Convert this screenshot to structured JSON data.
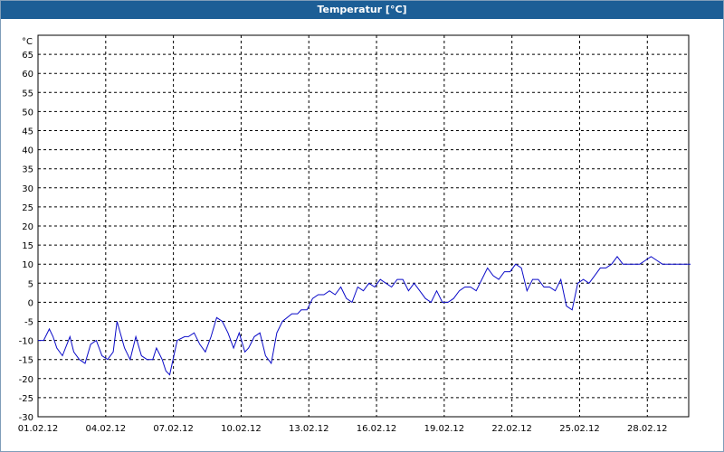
{
  "window": {
    "title": "Temperatur [°C]"
  },
  "colors": {
    "titlebar": "#1c5e96",
    "line": "#0a0ac8",
    "grid": "#000000"
  },
  "chart_data": {
    "type": "line",
    "title": "Temperatur [°C]",
    "ylabel": "°C",
    "xlabel": "",
    "ylim": [
      -30,
      70
    ],
    "xlim": [
      "2012-02-01",
      "2012-02-29"
    ],
    "grid": true,
    "y_ticks": [
      -30,
      -25,
      -20,
      -15,
      -10,
      -5,
      0,
      5,
      10,
      15,
      20,
      25,
      30,
      35,
      40,
      45,
      50,
      55,
      60,
      65
    ],
    "x_ticks": [
      {
        "date": "2012-02-01",
        "label": "01.02.12"
      },
      {
        "date": "2012-02-04",
        "label": "04.02.12"
      },
      {
        "date": "2012-02-07",
        "label": "07.02.12"
      },
      {
        "date": "2012-02-10",
        "label": "10.02.12"
      },
      {
        "date": "2012-02-13",
        "label": "13.02.12"
      },
      {
        "date": "2012-02-16",
        "label": "16.02.12"
      },
      {
        "date": "2012-02-19",
        "label": "19.02.12"
      },
      {
        "date": "2012-02-22",
        "label": "22.02.12"
      },
      {
        "date": "2012-02-25",
        "label": "25.02.12"
      },
      {
        "date": "2012-02-28",
        "label": "28.02.12"
      }
    ],
    "series": [
      {
        "x": [
          "2012-02-01 00:00",
          "2012-02-01 06:00",
          "2012-02-01 12:00",
          "2012-02-01 16:00",
          "2012-02-01 20:00",
          "2012-02-02 02:00",
          "2012-02-02 10:00",
          "2012-02-02 14:00",
          "2012-02-02 20:00",
          "2012-02-03 02:00",
          "2012-02-03 08:00",
          "2012-02-03 14:00",
          "2012-02-03 20:00",
          "2012-02-04 02:00",
          "2012-02-04 08:00",
          "2012-02-04 12:00",
          "2012-02-04 20:00",
          "2012-02-05 02:00",
          "2012-02-05 08:00",
          "2012-02-05 14:00",
          "2012-02-05 20:00",
          "2012-02-06 02:00",
          "2012-02-06 06:00",
          "2012-02-06 12:00",
          "2012-02-06 16:00",
          "2012-02-06 20:00",
          "2012-02-07 04:00",
          "2012-02-07 12:00",
          "2012-02-07 16:00",
          "2012-02-07 22:00",
          "2012-02-08 04:00",
          "2012-02-08 10:00",
          "2012-02-08 16:00",
          "2012-02-08 22:00",
          "2012-02-09 04:00",
          "2012-02-09 10:00",
          "2012-02-09 16:00",
          "2012-02-09 22:00",
          "2012-02-10 04:00",
          "2012-02-10 08:00",
          "2012-02-10 14:00",
          "2012-02-10 20:00",
          "2012-02-11 02:00",
          "2012-02-11 08:00",
          "2012-02-11 14:00",
          "2012-02-11 20:00",
          "2012-02-12 06:00",
          "2012-02-12 12:00",
          "2012-02-12 16:00",
          "2012-02-12 22:00",
          "2012-02-13 04:00",
          "2012-02-13 10:00",
          "2012-02-13 16:00",
          "2012-02-13 22:00",
          "2012-02-14 04:00",
          "2012-02-14 10:00",
          "2012-02-14 16:00",
          "2012-02-14 22:00",
          "2012-02-15 04:00",
          "2012-02-15 10:00",
          "2012-02-15 16:00",
          "2012-02-15 22:00",
          "2012-02-16 04:00",
          "2012-02-16 10:00",
          "2012-02-16 16:00",
          "2012-02-16 22:00",
          "2012-02-17 04:00",
          "2012-02-17 10:00",
          "2012-02-17 16:00",
          "2012-02-17 22:00",
          "2012-02-18 04:00",
          "2012-02-18 10:00",
          "2012-02-18 16:00",
          "2012-02-18 22:00",
          "2012-02-19 04:00",
          "2012-02-19 10:00",
          "2012-02-19 16:00",
          "2012-02-19 22:00",
          "2012-02-20 04:00",
          "2012-02-20 10:00",
          "2012-02-20 16:00",
          "2012-02-20 22:00",
          "2012-02-21 04:00",
          "2012-02-21 10:00",
          "2012-02-21 16:00",
          "2012-02-21 22:00",
          "2012-02-22 04:00",
          "2012-02-22 10:00",
          "2012-02-22 16:00",
          "2012-02-22 22:00",
          "2012-02-23 04:00",
          "2012-02-23 10:00",
          "2012-02-23 16:00",
          "2012-02-23 22:00",
          "2012-02-24 04:00",
          "2012-02-24 10:00",
          "2012-02-24 16:00",
          "2012-02-24 22:00",
          "2012-02-25 04:00",
          "2012-02-25 10:00",
          "2012-02-25 16:00",
          "2012-02-25 22:00",
          "2012-02-26 04:00",
          "2012-02-26 10:00",
          "2012-02-26 16:00",
          "2012-02-26 22:00",
          "2012-02-27 04:00",
          "2012-02-27 10:00",
          "2012-02-27 16:00",
          "2012-02-27 22:00",
          "2012-02-28 04:00",
          "2012-02-28 10:00",
          "2012-02-28 16:00",
          "2012-02-28 22:00",
          "2012-02-29 04:00",
          "2012-02-29 10:00",
          "2012-02-29 16:00",
          "2012-02-29 22:00"
        ],
        "values": [
          -10,
          -10,
          -7,
          -9,
          -12,
          -14,
          -9,
          -13,
          -15,
          -16,
          -11,
          -10,
          -14,
          -15,
          -13,
          -5,
          -12,
          -15,
          -9,
          -14,
          -15,
          -15,
          -12,
          -15,
          -18,
          -19,
          -10,
          -9,
          -9,
          -8,
          -11,
          -13,
          -9,
          -4,
          -5,
          -8,
          -12,
          -8,
          -13,
          -12,
          -9,
          -8,
          -14,
          -16,
          -8,
          -5,
          -3,
          -3,
          -2,
          -2,
          1,
          2,
          2,
          3,
          2,
          4,
          1,
          0,
          4,
          3,
          5,
          4,
          6,
          5,
          4,
          6,
          6,
          3,
          5,
          3,
          1,
          0,
          3,
          0,
          0,
          1,
          3,
          4,
          4,
          3,
          6,
          9,
          7,
          6,
          8,
          8,
          10,
          9,
          3,
          6,
          6,
          4,
          4,
          3,
          6,
          -1,
          -2,
          5,
          6,
          5,
          7,
          9,
          9,
          10,
          12,
          10,
          10,
          10,
          10,
          11,
          12,
          11,
          10,
          10,
          10,
          10,
          10,
          10
        ]
      }
    ]
  }
}
